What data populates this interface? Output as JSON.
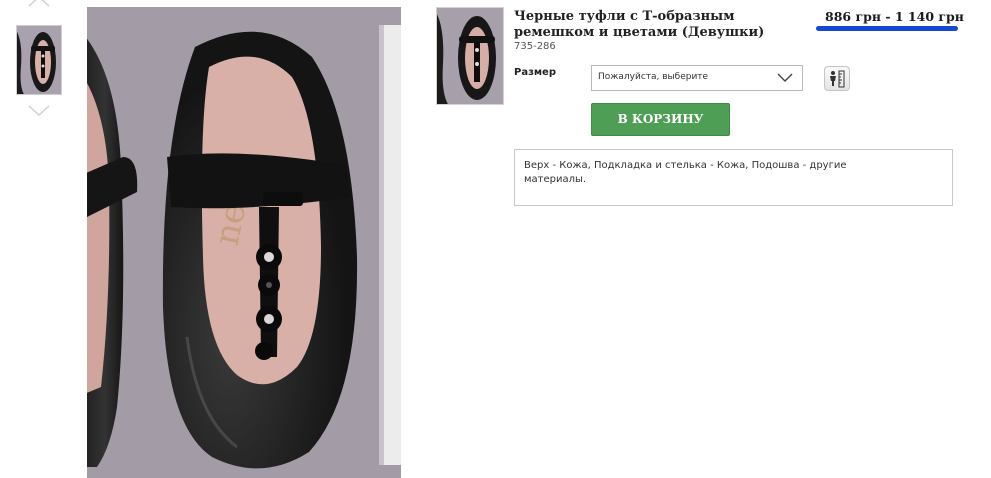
{
  "product": {
    "title": "Черные туфли с Т-образным ремешком и цветами (Девушки)",
    "sku": "735-286",
    "price": "886 грн - 1 140 грн",
    "size_label": "Размер",
    "size_select_value": "Пожалуйста, выберите",
    "cart_button_label": "В КОРЗИНУ",
    "description": "Верх - Кожа, Подкладка и стелька - Кожа, Подошва - другие материалы."
  },
  "icons": {
    "gallery_prev": "chevron-up-icon",
    "gallery_next": "chevron-down-icon",
    "select_arrow": "chevron-down-icon",
    "size_guide": "size-guide-icon"
  },
  "colors": {
    "cart_button": "#4f9e55",
    "price_underline": "#1648d6"
  }
}
